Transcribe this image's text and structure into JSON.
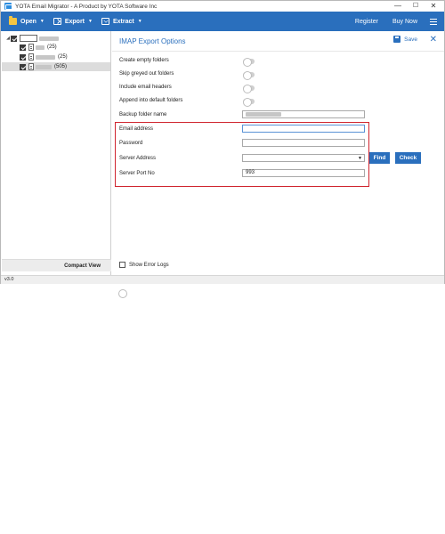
{
  "window": {
    "title": "YOTA Email Migrator - A Product by YOTA Software Inc",
    "min": "—",
    "max": "☐",
    "close": "✕"
  },
  "toolbar": {
    "open": "Open",
    "export": "Export",
    "extract": "Extract",
    "register": "Register",
    "buy_now": "Buy Now"
  },
  "tree": {
    "items": [
      {
        "count": ""
      },
      {
        "count": "(25)"
      },
      {
        "count": "(25)"
      },
      {
        "count": "(505)"
      }
    ]
  },
  "compact_view": {
    "label": "Compact View"
  },
  "panel": {
    "title": "IMAP Export Options",
    "save": "Save",
    "options": [
      "Create empty folders",
      "Skip greyed out folders",
      "Include email headers",
      "Append into default folders"
    ],
    "backup_label": "Backup folder name",
    "email_label": "Email address",
    "password_label": "Password",
    "server_label": "Server Address",
    "port_label": "Server Port No",
    "port_value": "993",
    "find": "Find",
    "check": "Check",
    "error_logs": "Show Error Logs"
  },
  "status": {
    "version": "v3.0"
  },
  "colors": {
    "accent": "#2a6fbd",
    "highlight_box": "#d0252f"
  }
}
